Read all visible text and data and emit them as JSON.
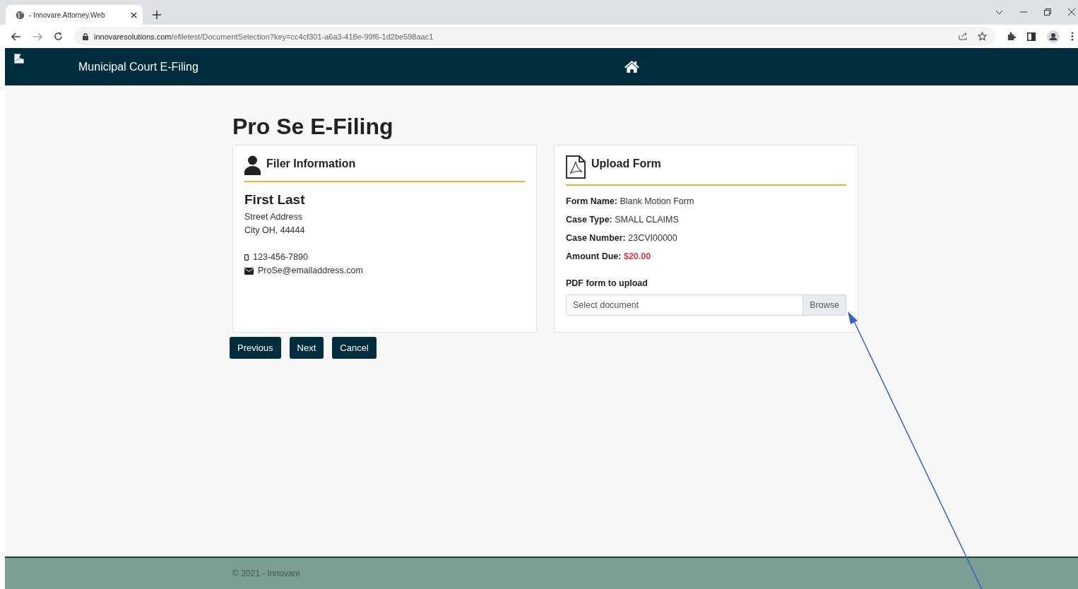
{
  "browser": {
    "tab_title": "- Innovare.Attorney.Web",
    "url_host": "innovaresolutions.com",
    "url_path": "/efiletest/DocumentSelection?key=cc4cf301-a6a3-418e-99f6-1d2be598aac1"
  },
  "header": {
    "title": "Municipal Court E-Filing"
  },
  "page_title": "Pro Se E-Filing",
  "filer": {
    "heading": "Filer Information",
    "name": "First Last",
    "address": [
      "Street Address",
      "City OH, 44444"
    ],
    "phone": "123-456-7890",
    "email": "ProSe@emailaddress.com"
  },
  "upload": {
    "heading": "Upload Form",
    "details": [
      {
        "label": "Form Name:",
        "value": "Blank Motion Form",
        "kind": "plain"
      },
      {
        "label": "Case Type:",
        "value": "SMALL CLAIMS",
        "kind": "plain"
      },
      {
        "label": "Case Number:",
        "value": "23CVI00000",
        "kind": "plain"
      },
      {
        "label": "Amount Due:",
        "value": "$20.00",
        "kind": "amount"
      }
    ],
    "field_label": "PDF form to upload",
    "placeholder": "Select document",
    "browse": "Browse"
  },
  "buttons": [
    "Previous",
    "Next",
    "Cancel"
  ],
  "footer": "© 2021 - Innovare"
}
